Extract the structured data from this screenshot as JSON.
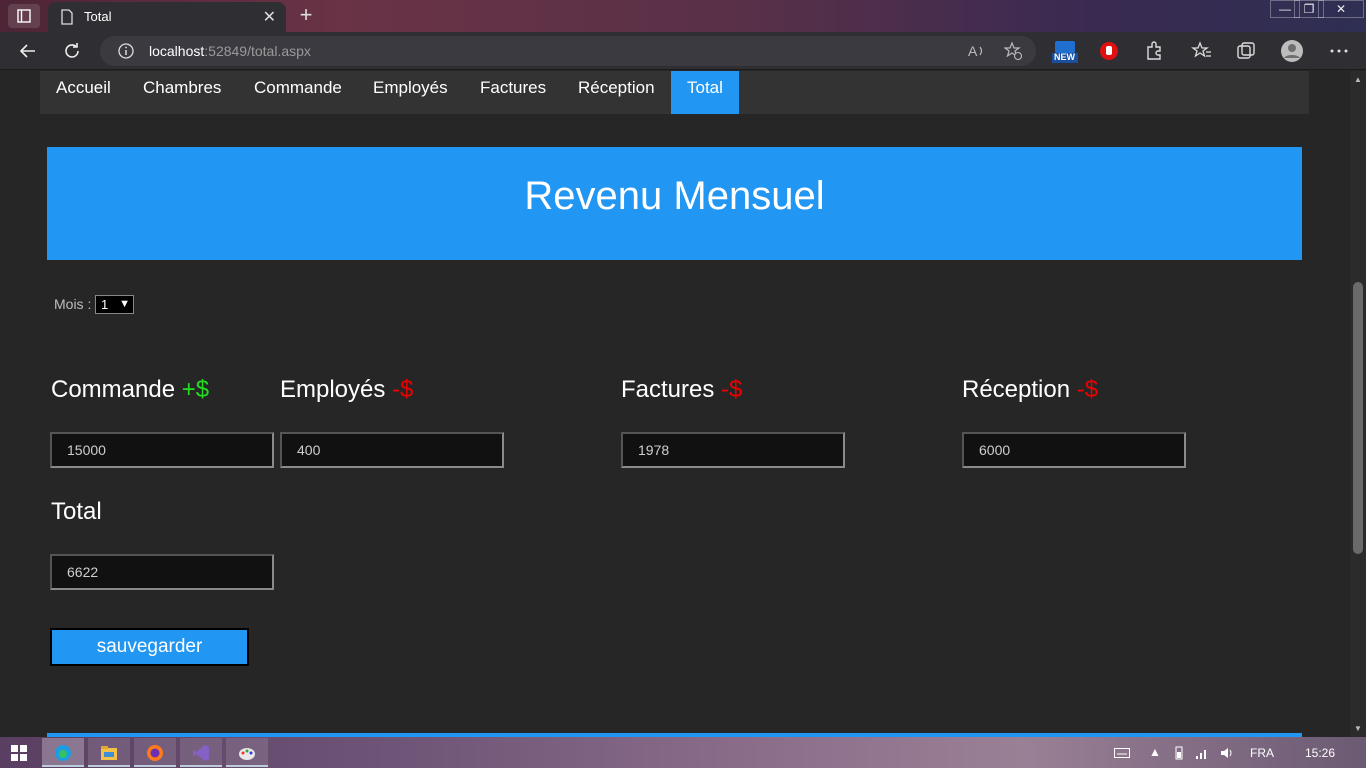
{
  "browser": {
    "tab_title": "Total",
    "tab_close": "✕",
    "new_tab": "+",
    "url_host": "localhost",
    "url_path": ":52849/total.aspx",
    "new_badge": "NEW",
    "window_controls": [
      "—",
      "❐",
      "✕"
    ]
  },
  "nav": {
    "items": [
      "Accueil",
      "Chambres",
      "Commande",
      "Employés",
      "Factures",
      "Réception",
      "Total"
    ],
    "active": "Total"
  },
  "banner": {
    "title": "Revenu Mensuel"
  },
  "mois": {
    "label": "Mois :",
    "value": "1"
  },
  "sections": {
    "commande": {
      "title": "Commande",
      "sign": "+$",
      "value": "15000"
    },
    "employes": {
      "title": "Employés",
      "sign": "-$",
      "value": "400"
    },
    "factures": {
      "title": "Factures",
      "sign": "-$",
      "value": "1978"
    },
    "reception": {
      "title": "Réception",
      "sign": "-$",
      "value": "6000"
    },
    "total": {
      "title": "Total",
      "value": "6622"
    }
  },
  "save_button": {
    "label": "sauvegarder"
  },
  "colors": {
    "accent": "#2196f3",
    "positive": "#22dd22",
    "negative": "#ee0000",
    "background": "#262626"
  },
  "taskbar": {
    "icons": [
      "windows-start-icon",
      "edge-icon",
      "file-explorer-icon",
      "firefox-icon",
      "visual-studio-icon",
      "paint-icon"
    ],
    "language": "FRA",
    "time": "15:26"
  }
}
